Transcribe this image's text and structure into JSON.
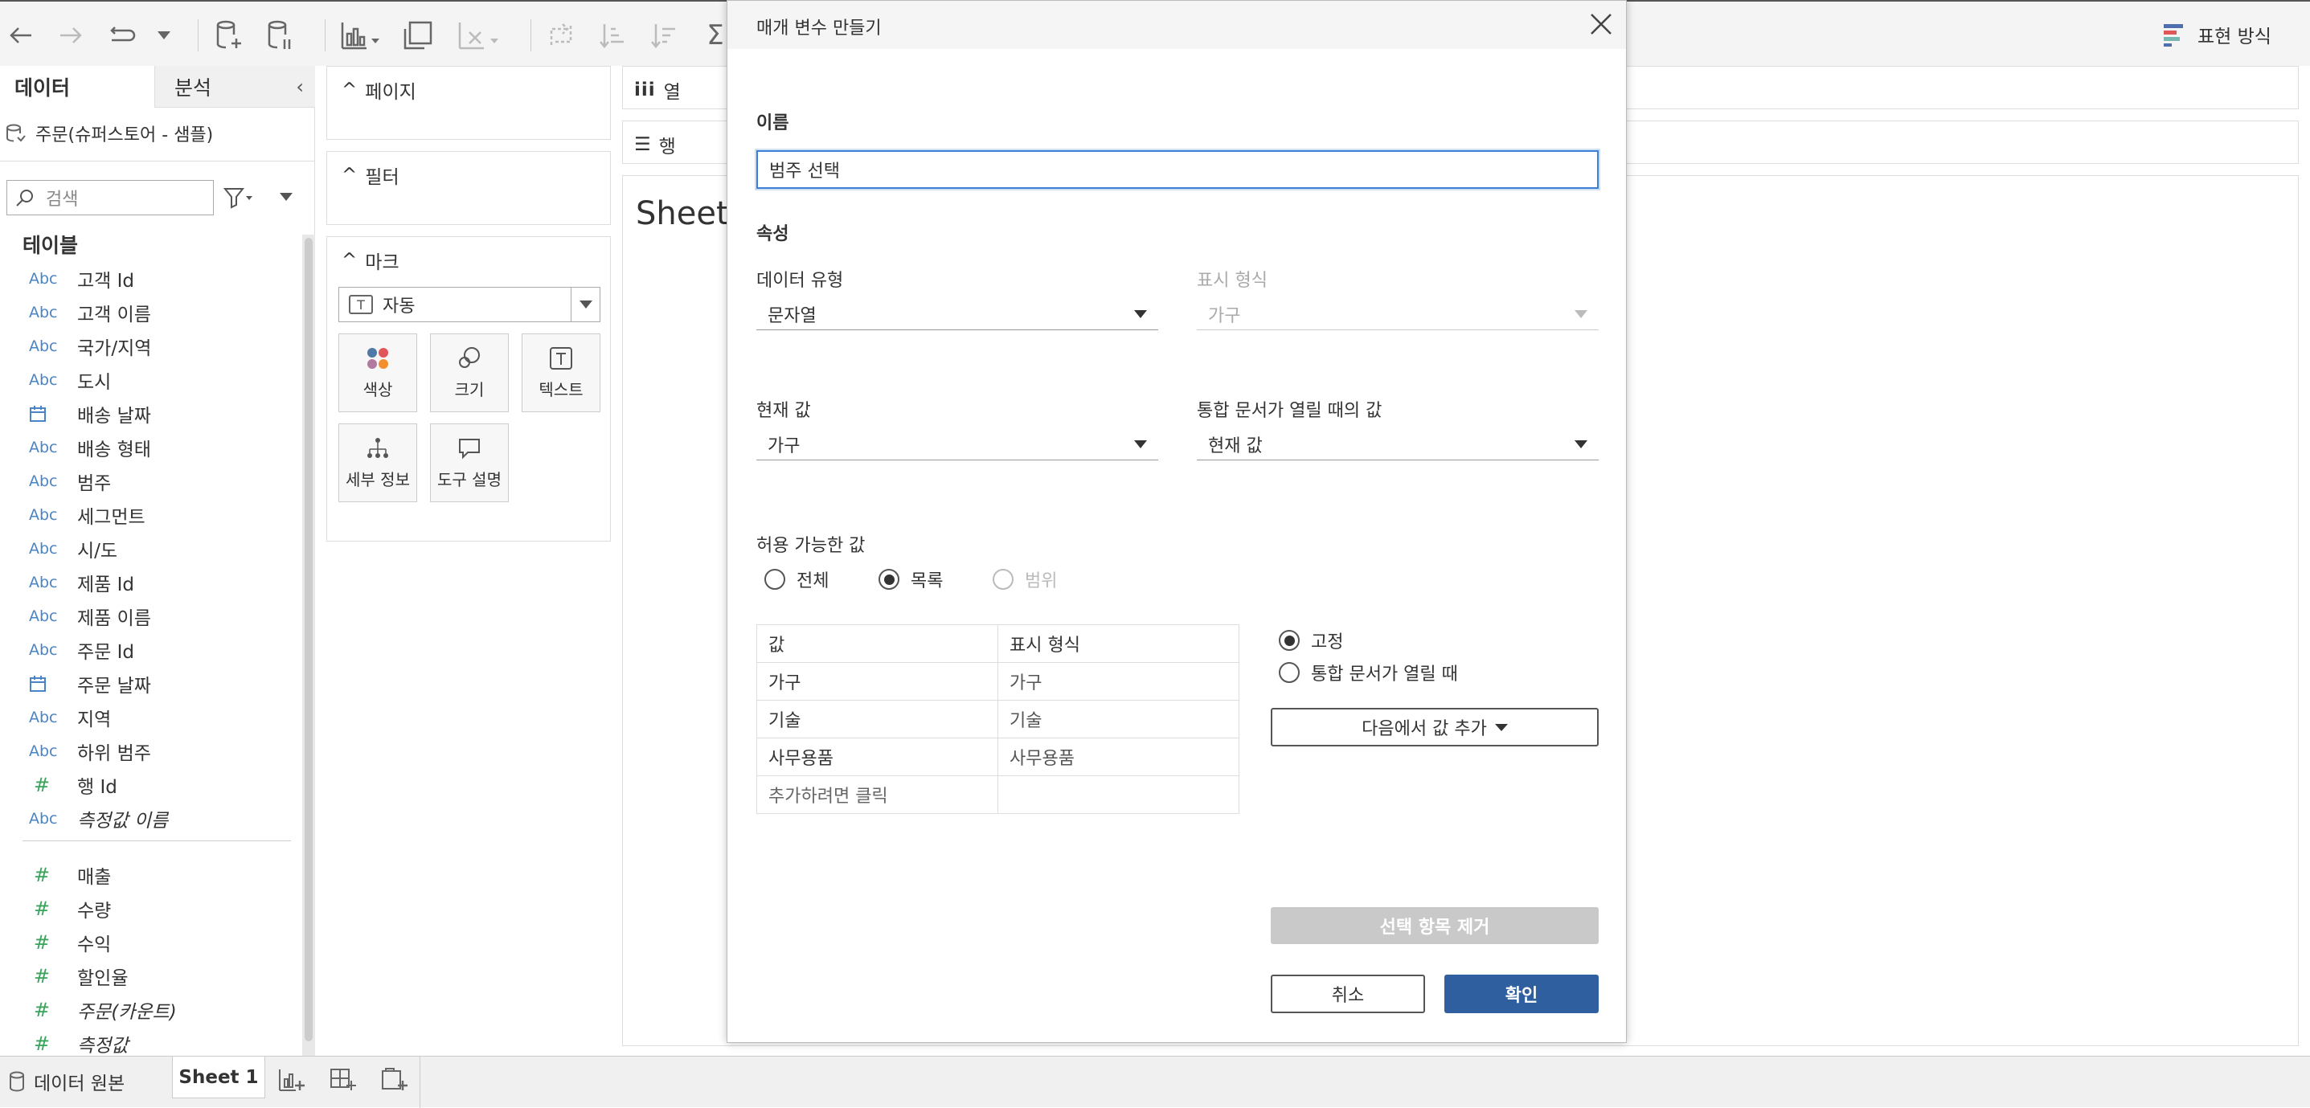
{
  "left_panel": {
    "tab_data": "데이터",
    "tab_analysis": "분석",
    "datasource": "주문(슈퍼스토어 - 샘플)",
    "search_placeholder": "검색",
    "tables_header": "테이블",
    "fields": [
      {
        "type": "Abc",
        "name": "고객 Id"
      },
      {
        "type": "Abc",
        "name": "고객 이름"
      },
      {
        "type": "Abc",
        "name": "국가/지역"
      },
      {
        "type": "Abc",
        "name": "도시"
      },
      {
        "type": "calendar-icon",
        "name": "배송 날짜"
      },
      {
        "type": "Abc",
        "name": "배송 형태"
      },
      {
        "type": "Abc",
        "name": "범주"
      },
      {
        "type": "Abc",
        "name": "세그먼트"
      },
      {
        "type": "Abc",
        "name": "시/도"
      },
      {
        "type": "Abc",
        "name": "제품 Id"
      },
      {
        "type": "Abc",
        "name": "제품 이름"
      },
      {
        "type": "Abc",
        "name": "주문 Id"
      },
      {
        "type": "calendar-icon",
        "name": "주문 날짜"
      },
      {
        "type": "Abc",
        "name": "지역"
      },
      {
        "type": "Abc",
        "name": "하위 범주"
      },
      {
        "type": "#",
        "name": "행 Id"
      },
      {
        "type": "Abc",
        "name": "측정값 이름"
      }
    ],
    "measures": [
      {
        "type": "#",
        "name": "매출"
      },
      {
        "type": "#",
        "name": "수량"
      },
      {
        "type": "#",
        "name": "수익"
      },
      {
        "type": "#",
        "name": "할인율"
      },
      {
        "type": "#",
        "name": "주문(카운트)"
      },
      {
        "type": "#",
        "name": "측정값"
      }
    ]
  },
  "shelves": {
    "pages": "페이지",
    "filters": "필터",
    "marks": "마크",
    "mark_type": "자동",
    "mark_buttons": [
      "색상",
      "크기",
      "텍스트",
      "세부 정보",
      "도구 설명"
    ],
    "columns": "열",
    "rows": "행",
    "sheet_title": "Sheet 1"
  },
  "toolbar": {
    "show_me": "표현 방식"
  },
  "dialog": {
    "title": "매개 변수 만들기",
    "name_label": "이름",
    "name_value": "범주 선택",
    "properties_label": "속성",
    "data_type_label": "데이터 유형",
    "data_type_value": "문자열",
    "display_format_label": "표시 형식",
    "display_format_value": "가구",
    "current_value_label": "현재 값",
    "current_value": "가구",
    "workbook_open_label": "통합 문서가 열릴 때의 값",
    "workbook_open_value": "현재 값",
    "allowable_label": "허용 가능한 값",
    "allowable_options": [
      "전체",
      "목록",
      "범위"
    ],
    "allowable_selected": "목록",
    "table_headers": [
      "값",
      "표시 형식"
    ],
    "table_rows": [
      [
        "가구",
        "가구"
      ],
      [
        "기술",
        "기술"
      ],
      [
        "사무용품",
        "사무용품"
      ],
      [
        "추가하려면 클릭",
        ""
      ]
    ],
    "fixed_option": "고정",
    "on_open_option": "통합 문서가 열릴 때",
    "add_from_button": "다음에서 값 추가",
    "remove_button": "선택 항목 제거",
    "cancel_button": "취소",
    "ok_button": "확인"
  },
  "bottom": {
    "datasource_tab": "데이터 원본",
    "sheet_tab": "Sheet 1"
  },
  "colors": {
    "accent_blue": "#2f5f9e",
    "focus_border": "#3d7fd6",
    "field_icon_blue": "#4a84c4",
    "measure_green": "#3aa35c"
  }
}
